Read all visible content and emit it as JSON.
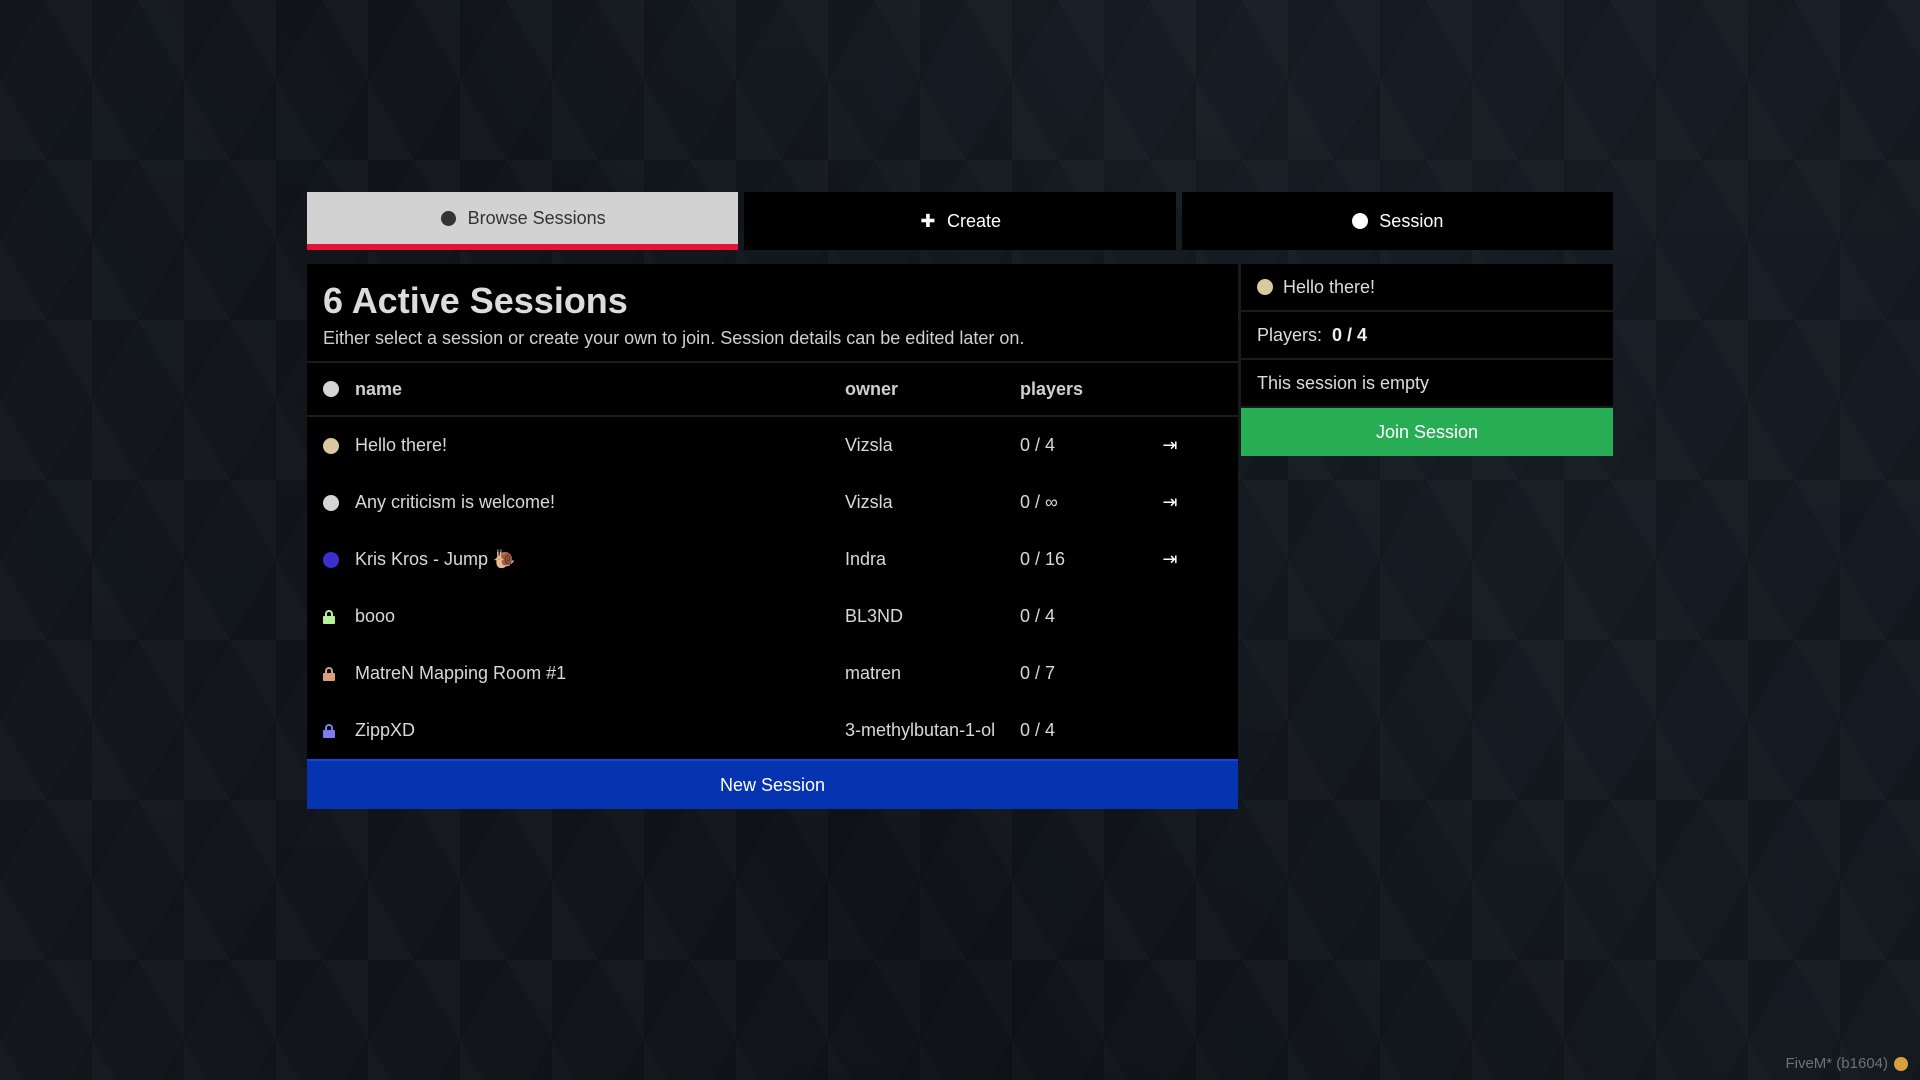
{
  "tabs": [
    {
      "label": "Browse Sessions",
      "icon": "globe-icon",
      "active": true
    },
    {
      "label": "Create",
      "icon": "plus-icon",
      "active": false
    },
    {
      "label": "Session",
      "icon": "circle-icon",
      "active": false
    }
  ],
  "main": {
    "title": "6 Active Sessions",
    "subtitle": "Either select a session or create your own to join. Session details can be edited later on.",
    "columns": {
      "name": "name",
      "owner": "owner",
      "players": "players"
    },
    "rows": [
      {
        "name": "Hello there!",
        "owner": "Vizsla",
        "players": "0 / 4",
        "indicator": "dot",
        "color": "#d8c9a0",
        "joinable": true
      },
      {
        "name": "Any criticism is welcome!",
        "owner": "Vizsla",
        "players": "0 / ∞",
        "indicator": "dot",
        "color": "#d6d6d6",
        "joinable": true
      },
      {
        "name": "Kris Kros - Jump 🐌",
        "owner": "Indra",
        "players": "0 / 16",
        "indicator": "dot",
        "color": "#3a2fcf",
        "joinable": true
      },
      {
        "name": "booo",
        "owner": "BL3ND",
        "players": "0 / 4",
        "indicator": "lock",
        "color": "#b6f29a",
        "joinable": false
      },
      {
        "name": "MatreN Mapping Room #1",
        "owner": "matren",
        "players": "0 / 7",
        "indicator": "lock",
        "color": "#d99f7a",
        "joinable": false
      },
      {
        "name": "ZippXD",
        "owner": "3-methylbutan-1-ol",
        "players": "0 / 4",
        "indicator": "lock",
        "color": "#7c7cf0",
        "joinable": false
      }
    ],
    "new_session_label": "New Session"
  },
  "side": {
    "session_name": "Hello there!",
    "session_color": "#d8c9a0",
    "players_label": "Players:",
    "players_value": "0 / 4",
    "empty_text": "This session is empty",
    "join_label": "Join Session"
  },
  "footer": {
    "text": "FiveM* (b1604)"
  },
  "colors": {
    "accent_red": "#e8113a",
    "blue_button": "#0633b0",
    "green_button": "#27ae55"
  }
}
